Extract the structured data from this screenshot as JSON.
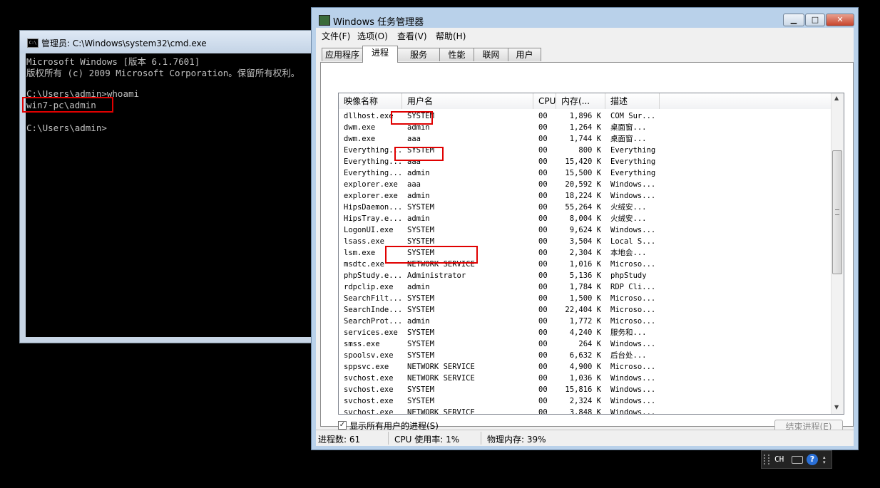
{
  "cmd": {
    "title": "管理员: C:\\Windows\\system32\\cmd.exe",
    "lines": [
      "Microsoft Windows [版本 6.1.7601]",
      "版权所有 (c) 2009 Microsoft Corporation。保留所有权利。",
      "",
      "C:\\Users\\admin>whoami",
      "win7-pc\\admin",
      "",
      "C:\\Users\\admin>"
    ]
  },
  "taskmgr": {
    "title": "Windows 任务管理器",
    "menu": [
      "文件(F)",
      "选项(O)",
      "查看(V)",
      "帮助(H)"
    ],
    "tabs": [
      "应用程序",
      "进程",
      "服务",
      "性能",
      "联网",
      "用户"
    ],
    "active_tab": "进程",
    "columns": [
      "映像名称",
      "用户名",
      "CPU",
      "内存(...",
      "描述"
    ],
    "rows": [
      [
        "dllhost.exe",
        "SYSTEM",
        "00",
        "1,896 K",
        "COM Sur..."
      ],
      [
        "dwm.exe",
        "admin",
        "00",
        "1,264 K",
        "桌面窗..."
      ],
      [
        "dwm.exe",
        "aaa",
        "00",
        "1,744 K",
        "桌面窗..."
      ],
      [
        "Everything...",
        "SYSTEM",
        "00",
        "800 K",
        "Everything"
      ],
      [
        "Everything...",
        "aaa",
        "00",
        "15,420 K",
        "Everything"
      ],
      [
        "Everything...",
        "admin",
        "00",
        "15,500 K",
        "Everything"
      ],
      [
        "explorer.exe",
        "aaa",
        "00",
        "20,592 K",
        "Windows..."
      ],
      [
        "explorer.exe",
        "admin",
        "00",
        "18,224 K",
        "Windows..."
      ],
      [
        "HipsDaemon....",
        "SYSTEM",
        "00",
        "55,264 K",
        "火绒安..."
      ],
      [
        "HipsTray.e...",
        "admin",
        "00",
        "8,004 K",
        "火绒安..."
      ],
      [
        "LogonUI.exe",
        "SYSTEM",
        "00",
        "9,624 K",
        "Windows..."
      ],
      [
        "lsass.exe",
        "SYSTEM",
        "00",
        "3,504 K",
        "Local S..."
      ],
      [
        "lsm.exe",
        "SYSTEM",
        "00",
        "2,304 K",
        "本地会..."
      ],
      [
        "msdtc.exe",
        "NETWORK SERVICE",
        "00",
        "1,016 K",
        "Microso..."
      ],
      [
        "phpStudy.e...",
        "Administrator",
        "00",
        "5,136 K",
        "phpStudy"
      ],
      [
        "rdpclip.exe",
        "admin",
        "00",
        "1,784 K",
        "RDP Cli..."
      ],
      [
        "SearchFilt...",
        "SYSTEM",
        "00",
        "1,500 K",
        "Microso..."
      ],
      [
        "SearchInde...",
        "SYSTEM",
        "00",
        "22,404 K",
        "Microso..."
      ],
      [
        "SearchProt...",
        "admin",
        "00",
        "1,772 K",
        "Microso..."
      ],
      [
        "services.exe",
        "SYSTEM",
        "00",
        "4,240 K",
        "服务和..."
      ],
      [
        "smss.exe",
        "SYSTEM",
        "00",
        "264 K",
        "Windows..."
      ],
      [
        "spoolsv.exe",
        "SYSTEM",
        "00",
        "6,632 K",
        "后台处..."
      ],
      [
        "sppsvc.exe",
        "NETWORK SERVICE",
        "00",
        "4,900 K",
        "Microso..."
      ],
      [
        "svchost.exe",
        "NETWORK SERVICE",
        "00",
        "1,036 K",
        "Windows..."
      ],
      [
        "svchost.exe",
        "SYSTEM",
        "00",
        "15,816 K",
        "Windows..."
      ],
      [
        "svchost.exe",
        "SYSTEM",
        "00",
        "2,324 K",
        "Windows..."
      ],
      [
        "svchost.exe",
        "NETWORK SERVICE",
        "00",
        "3,848 K",
        "Windows..."
      ]
    ],
    "show_all_users_label": "显示所有用户的进程(S)",
    "show_all_users_checked": true,
    "end_process_label": "结束进程(E)",
    "status": {
      "processes": "进程数: 61",
      "cpu": "CPU 使用率: 1%",
      "memory": "物理内存: 39%"
    }
  },
  "tray": {
    "language": "CH",
    "help_symbol": "?"
  },
  "colors": {
    "highlight_box": "#e00000",
    "console_bg": "#000000",
    "console_fg": "#c0c0c0"
  }
}
